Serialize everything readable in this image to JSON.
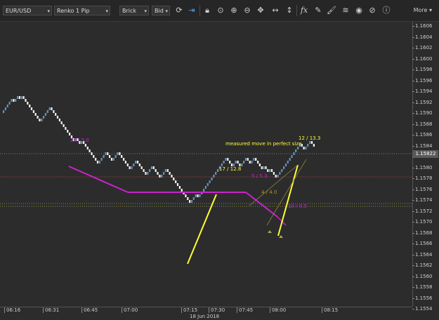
{
  "toolbar": {
    "symbol": "EUR/USD",
    "chart_type": "Renko 1 Pip",
    "brick_type": "Brick",
    "price_source": "Bid",
    "more_label": "More",
    "icons": [
      "refresh-icon",
      "forward-icon",
      "lock-icon",
      "zoom-fit-icon",
      "zoom-in-icon",
      "zoom-out-icon",
      "move-icon",
      "scale-icon",
      "indicator-icon",
      "draw-icon",
      "brush-icon",
      "layers-icon",
      "eye-icon",
      "hide-icon",
      "info-icon"
    ]
  },
  "chart": {
    "current_price": "1.15822",
    "annotation_main": "measured move in perfect size",
    "label_up_1": "17 / 12.8",
    "label_up_2": "12 / 13.3",
    "label_pink_1": "20 / 5.0",
    "label_pink_2": "5 / 5.3",
    "label_pink_3": "4 / 4.0",
    "label_pink_4": "10 / 8.5"
  },
  "yaxis": {
    "ticks": [
      "1.1606",
      "1.1604",
      "1.1602",
      "1.1600",
      "1.1598",
      "1.1596",
      "1.1594",
      "1.1592",
      "1.1590",
      "1.1588",
      "1.1586",
      "1.1584",
      "1.1582",
      "1.1580",
      "1.1578",
      "1.1576",
      "1.1574",
      "1.1572",
      "1.1570",
      "1.1568",
      "1.1566",
      "1.1564",
      "1.1562",
      "1.1560",
      "1.1558",
      "1.1556",
      "1.1554"
    ]
  },
  "xaxis": {
    "ticks": [
      "06:16",
      "06:31",
      "06:45",
      "07:00",
      "07:15",
      "07:30",
      "07:45",
      "08:00",
      "08:15"
    ],
    "date": "18 Jun 2018"
  },
  "colors": {
    "brick_up": "#6a8fb8",
    "brick_down": "#f2f2f2",
    "trend_yellow": "#ffff33",
    "trend_magenta": "#cc22cc"
  }
}
